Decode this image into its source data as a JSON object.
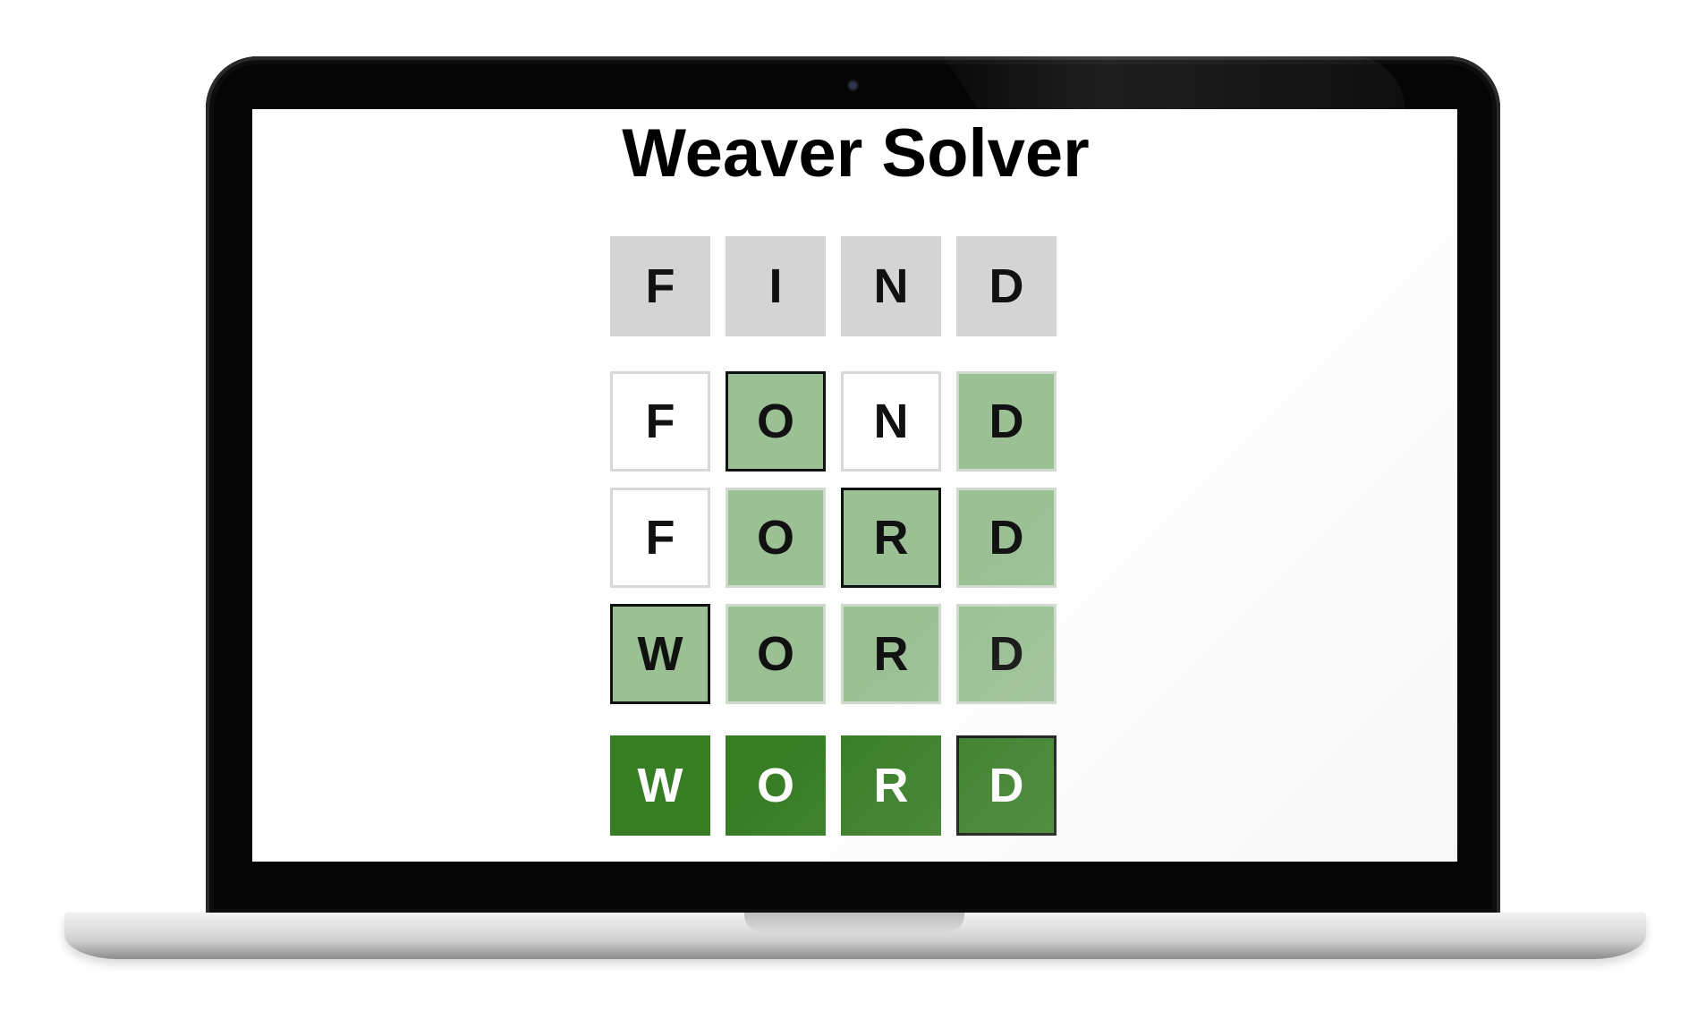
{
  "app": {
    "title": "Weaver Solver"
  },
  "colors": {
    "start_tile": "#d4d4d4",
    "match_tile": "#9ac094",
    "target_tile": "#367d24",
    "changed_outline": "#111111"
  },
  "start_word": {
    "letters": [
      "F",
      "I",
      "N",
      "D"
    ]
  },
  "ladder": [
    {
      "word": "FOND",
      "letters": [
        "F",
        "O",
        "N",
        "D"
      ],
      "states": [
        "white",
        "match",
        "white",
        "match"
      ],
      "changed_index": 1
    },
    {
      "word": "FORD",
      "letters": [
        "F",
        "O",
        "R",
        "D"
      ],
      "states": [
        "white",
        "match",
        "match",
        "match"
      ],
      "changed_index": 2
    },
    {
      "word": "WORD",
      "letters": [
        "W",
        "O",
        "R",
        "D"
      ],
      "states": [
        "match",
        "match",
        "match",
        "match"
      ],
      "changed_index": 0
    }
  ],
  "target_word": {
    "letters": [
      "W",
      "O",
      "R",
      "D"
    ],
    "changed_index": 3
  }
}
